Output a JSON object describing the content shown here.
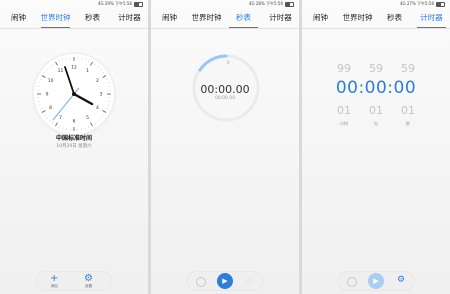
{
  "status_bar": {
    "p1": "4G 29% 下午5:56",
    "p2": "4G 28% 下午5:56",
    "p3": "4G 27% 下午5:56"
  },
  "tabs": [
    "闹钟",
    "世界时钟",
    "秒表",
    "计时器"
  ],
  "colors": {
    "accent": "#2f7dd9"
  },
  "world_clock": {
    "dial_numbers": [
      "12",
      "1",
      "2",
      "3",
      "4",
      "5",
      "6",
      "7",
      "8",
      "9",
      "10",
      "11"
    ],
    "timezone_title": "中国标准时间",
    "timezone_subtitle": "10月20日 星期六",
    "add_label": "添加",
    "settings_label": "设置",
    "add_icon": "plus-icon",
    "settings_icon": "gear-icon"
  },
  "stopwatch": {
    "ring_top_number": "0",
    "time": "00:00.00",
    "sub_time": "00:00.00",
    "play_icon": "play-icon"
  },
  "timer": {
    "above": [
      "99",
      "59",
      "59"
    ],
    "display": "00:00:00",
    "below": [
      "01",
      "01",
      "01"
    ],
    "units": [
      "小时",
      "分",
      "秒"
    ],
    "settings_icon": "gear-icon"
  }
}
